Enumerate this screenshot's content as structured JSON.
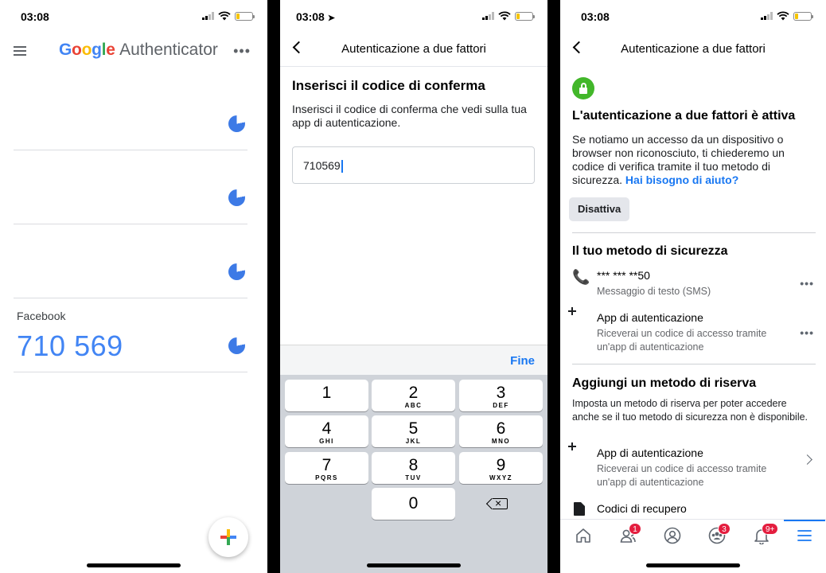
{
  "screen1": {
    "time": "03:08",
    "title_brand": "Google",
    "title_product": "Authenticator",
    "menu_icon": "hamburger-icon",
    "more_icon": "more-dots-icon",
    "more_label": "•••",
    "accounts": [
      {
        "name": "",
        "code": ""
      },
      {
        "name": "",
        "code": ""
      },
      {
        "name": "",
        "code": ""
      },
      {
        "name": "Facebook",
        "code": "710 569"
      }
    ],
    "add_button_icon": "plus-icon",
    "google_colors": {
      "blue": "#4285F4",
      "red": "#EA4335",
      "yellow": "#FBBC05",
      "green": "#34A853"
    }
  },
  "screen2": {
    "time": "03:08",
    "nav_title": "Autenticazione a due fattori",
    "heading": "Inserisci il codice di conferma",
    "description": "Inserisci il codice di conferma che vedi sulla tua app di autenticazione.",
    "input_value": "710569",
    "done_label": "Fine",
    "keys": [
      {
        "num": "1",
        "letters": ""
      },
      {
        "num": "2",
        "letters": "ABC"
      },
      {
        "num": "3",
        "letters": "DEF"
      },
      {
        "num": "4",
        "letters": "GHI"
      },
      {
        "num": "5",
        "letters": "JKL"
      },
      {
        "num": "6",
        "letters": "MNO"
      },
      {
        "num": "7",
        "letters": "PQRS"
      },
      {
        "num": "8",
        "letters": "TUV"
      },
      {
        "num": "9",
        "letters": "WXYZ"
      },
      {
        "num": "0",
        "letters": ""
      }
    ],
    "delete_icon": "backspace-icon"
  },
  "screen3": {
    "time": "03:08",
    "nav_title": "Autenticazione a due fattori",
    "status_title": "L'autenticazione a due fattori è attiva",
    "status_desc": "Se notiamo un accesso da un dispositivo o browser non riconosciuto, ti chiederemo un codice di verifica tramite il tuo metodo di sicurezza.",
    "help_link": "Hai bisogno di aiuto?",
    "disable_button": "Disattiva",
    "security_heading": "Il tuo metodo di sicurezza",
    "methods": [
      {
        "icon": "phone-icon",
        "title": "*** *** **50",
        "subtitle": "Messaggio di testo (SMS)"
      },
      {
        "icon": "scan-icon",
        "title": "App di autenticazione",
        "subtitle": "Riceverai un codice di accesso tramite un'app di autenticazione"
      }
    ],
    "backup_heading": "Aggiungi un metodo di riserva",
    "backup_desc": "Imposta un metodo di riserva per poter accedere anche se il tuo metodo di sicurezza non è disponibile.",
    "backup_methods": [
      {
        "icon": "scan-icon",
        "title": "App di autenticazione",
        "subtitle": "Riceverai un codice di accesso tramite un'app di autenticazione"
      },
      {
        "icon": "document-icon",
        "title": "Codici di recupero",
        "subtitle": ""
      }
    ],
    "more_label": "•••",
    "tabs": [
      {
        "icon": "home-icon",
        "badge": ""
      },
      {
        "icon": "friends-icon",
        "badge": "1"
      },
      {
        "icon": "profile-icon",
        "badge": ""
      },
      {
        "icon": "groups-icon",
        "badge": "3"
      },
      {
        "icon": "bell-icon",
        "badge": "9+"
      },
      {
        "icon": "menu-icon",
        "badge": ""
      }
    ],
    "accent": "#1877F2",
    "success": "#42B72A",
    "badge_color": "#E41E3F"
  }
}
